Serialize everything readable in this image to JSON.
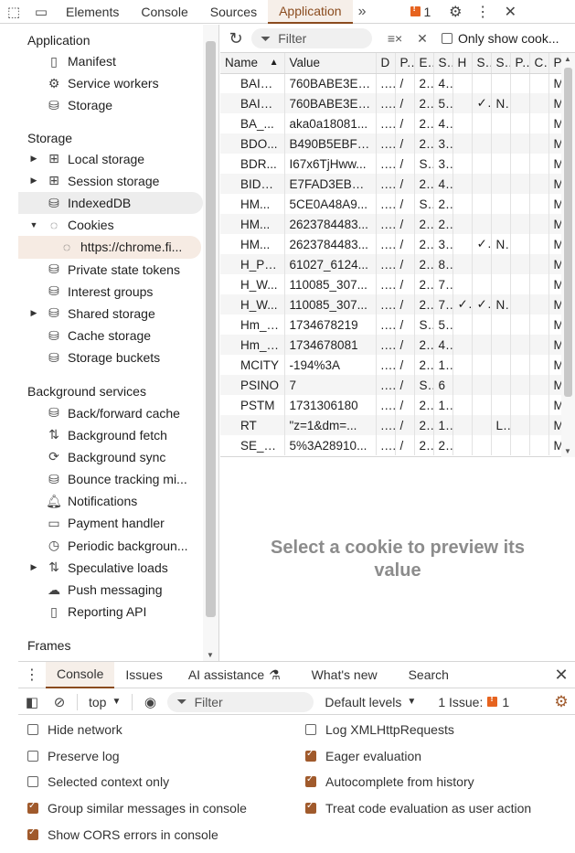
{
  "topbar": {
    "tabs": [
      "Elements",
      "Console",
      "Sources",
      "Application"
    ],
    "active_tab": "Application",
    "more": "»",
    "issues_count": "1"
  },
  "sidebar": {
    "application_title": "Application",
    "application_items": [
      "Manifest",
      "Service workers",
      "Storage"
    ],
    "storage_title": "Storage",
    "storage_items": {
      "local": "Local storage",
      "session": "Session storage",
      "indexeddb": "IndexedDB",
      "cookies": "Cookies",
      "cookie_origin": "https://chrome.fi...",
      "private_state": "Private state tokens",
      "interest": "Interest groups",
      "shared": "Shared storage",
      "cache": "Cache storage",
      "buckets": "Storage buckets"
    },
    "background_title": "Background services",
    "background_items": [
      "Back/forward cache",
      "Background fetch",
      "Background sync",
      "Bounce tracking mi...",
      "Notifications",
      "Payment handler",
      "Periodic backgroun...",
      "Speculative loads",
      "Push messaging",
      "Reporting API"
    ],
    "frames_title": "Frames"
  },
  "cookie_toolbar": {
    "filter_placeholder": "Filter",
    "only_show": "Only show cook..."
  },
  "cookies_table": {
    "headers": [
      "Name",
      "Value",
      "D",
      "P.",
      "E.",
      "S.",
      "H",
      "S.",
      "S.",
      "P.",
      "C.",
      "P."
    ],
    "rows": [
      [
        "BAID...",
        "760BABE3EE...",
        "....",
        "/",
        "2..",
        "4..",
        "",
        "",
        "",
        "",
        "",
        "M"
      ],
      [
        "BAID...",
        "760BABE3EE...",
        "....",
        "/",
        "2..",
        "5..",
        "",
        "✓",
        "N.",
        "",
        "",
        "M"
      ],
      [
        "BA_...",
        "aka0a18081...",
        "....",
        "/",
        "2..",
        "4..",
        "",
        "",
        "",
        "",
        "",
        "M"
      ],
      [
        "BDO...",
        "B490B5EBF6...",
        "....",
        "/",
        "2..",
        "3..",
        "",
        "",
        "",
        "",
        "",
        "M"
      ],
      [
        "BDR...",
        "I67x6TjHww...",
        "....",
        "/",
        "S..",
        "3..",
        "",
        "",
        "",
        "",
        "",
        "M"
      ],
      [
        "BIDU...",
        "E7FAD3EBFA...",
        "....",
        "/",
        "2..",
        "4..",
        "",
        "",
        "",
        "",
        "",
        "M"
      ],
      [
        "HM...",
        "5CE0A48A9...",
        "....",
        "/",
        "S..",
        "2..",
        "",
        "",
        "",
        "",
        "",
        "M"
      ],
      [
        "HM...",
        "2623784483...",
        "....",
        "/",
        "2..",
        "2..",
        "",
        "",
        "",
        "",
        "",
        "M"
      ],
      [
        "HM...",
        "2623784483...",
        "....",
        "/",
        "2..",
        "3..",
        "",
        "✓",
        "N.",
        "",
        "",
        "M"
      ],
      [
        "H_PS...",
        "61027_6124...",
        "....",
        "/",
        "2..",
        "8..",
        "",
        "",
        "",
        "",
        "",
        "M"
      ],
      [
        "H_W...",
        "110085_307...",
        "....",
        "/",
        "2..",
        "7..",
        "",
        "",
        "",
        "",
        "",
        "M"
      ],
      [
        "H_W...",
        "110085_307...",
        "....",
        "/",
        "2..",
        "7..",
        "✓",
        "✓",
        "N.",
        "",
        "",
        "M"
      ],
      [
        "Hm_l...",
        "1734678219",
        "....",
        "/",
        "S..",
        "5..",
        "",
        "",
        "",
        "",
        "",
        "M"
      ],
      [
        "Hm_l...",
        "1734678081",
        "....",
        "/",
        "2..",
        "4..",
        "",
        "",
        "",
        "",
        "",
        "M"
      ],
      [
        "MCITY",
        "-194%3A",
        "....",
        "/",
        "2..",
        "1..",
        "",
        "",
        "",
        "",
        "",
        "M"
      ],
      [
        "PSINO",
        "7",
        "....",
        "/",
        "S..",
        "6",
        "",
        "",
        "",
        "",
        "",
        "M"
      ],
      [
        "PSTM",
        "1731306180",
        "....",
        "/",
        "2..",
        "1..",
        "",
        "",
        "",
        "",
        "",
        "M"
      ],
      [
        "RT",
        "\"z=1&dm=...",
        "....",
        "/",
        "2..",
        "1..",
        "",
        "",
        "L..",
        "",
        "",
        "M"
      ],
      [
        "SE_L...",
        "5%3A28910...",
        "....",
        "/",
        "2..",
        "2..",
        "",
        "",
        "",
        "",
        "",
        "M"
      ]
    ]
  },
  "preview": {
    "message": "Select a cookie to preview its value"
  },
  "drawer": {
    "tabs": [
      "Console",
      "Issues",
      "AI assistance",
      "What's new",
      "Search"
    ],
    "active_tab": "Console",
    "context": "top",
    "filter_placeholder": "Filter",
    "levels": "Default levels",
    "issues_label": "1 Issue:",
    "issues_count": "1",
    "options": [
      {
        "label": "Hide network",
        "checked": false
      },
      {
        "label": "Log XMLHttpRequests",
        "checked": false
      },
      {
        "label": "Preserve log",
        "checked": false
      },
      {
        "label": "Eager evaluation",
        "checked": true
      },
      {
        "label": "Selected context only",
        "checked": false
      },
      {
        "label": "Autocomplete from history",
        "checked": true
      },
      {
        "label": "Group similar messages in console",
        "checked": true
      },
      {
        "label": "Treat code evaluation as user action",
        "checked": true
      },
      {
        "label": "Show CORS errors in console",
        "checked": true
      }
    ]
  },
  "colors": {
    "accent": "#8a4b1e",
    "checkbox": "#a05a2c",
    "issue": "#e6631f"
  }
}
